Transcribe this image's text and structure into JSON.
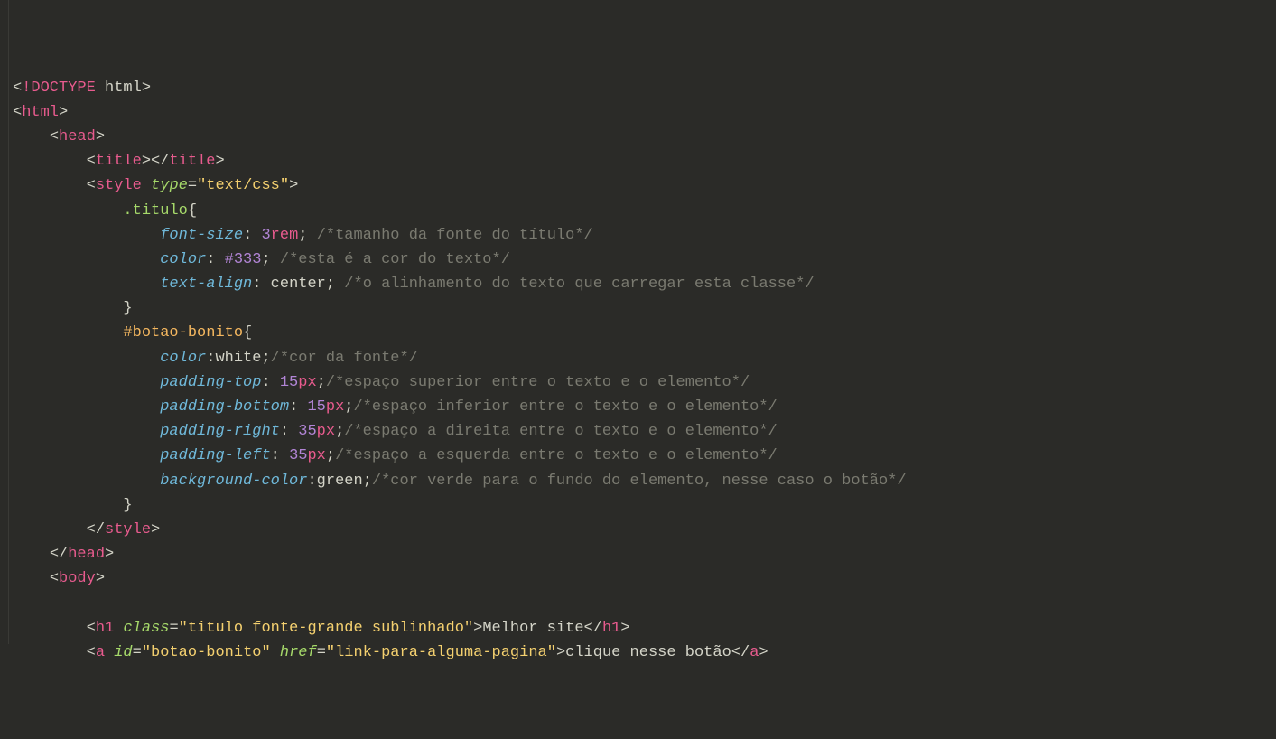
{
  "code": {
    "l1": {
      "lt": "<",
      "bang": "!",
      "kw": "DOCTYPE",
      "sp": " ",
      "val": "html",
      "gt": ">"
    },
    "l2": {
      "lt": "<",
      "tag": "html",
      "gt": ">"
    },
    "l3": {
      "ind": "    ",
      "lt": "<",
      "tag": "head",
      "gt": ">"
    },
    "l4": {
      "ind": "        ",
      "lt": "<",
      "tag": "title",
      "gt": ">",
      "lt2": "</",
      "tag2": "title",
      "gt2": ">"
    },
    "l5": {
      "ind": "        ",
      "lt": "<",
      "tag": "style",
      "sp": " ",
      "attr": "type",
      "eq": "=",
      "q1": "\"",
      "val": "text/css",
      "q2": "\"",
      "gt": ">"
    },
    "l6": {
      "ind": "            ",
      "sel": ".titulo",
      "brace": "{"
    },
    "l7": {
      "ind": "                ",
      "prop": "font-size",
      "colon": ": ",
      "num": "3",
      "unit": "rem",
      "semi": ";",
      "sp": " ",
      "cmt": "/*tamanho da fonte do título*/"
    },
    "l8": {
      "ind": "                ",
      "prop": "color",
      "colon": ": ",
      "hex": "#333",
      "semi": ";",
      "sp": " ",
      "cmt": "/*esta é a cor do texto*/"
    },
    "l9": {
      "ind": "                ",
      "prop": "text-align",
      "colon": ": ",
      "val": "center",
      "semi": ";",
      "sp": " ",
      "cmt": "/*o alinhamento do texto que carregar esta classe*/"
    },
    "l10": {
      "ind": "            ",
      "brace": "}"
    },
    "l11": {
      "ind": "            ",
      "sel": "#botao-bonito",
      "brace": "{"
    },
    "l12": {
      "ind": "                ",
      "prop": "color",
      "colon": ":",
      "val": "white",
      "semi": ";",
      "cmt": "/*cor da fonte*/"
    },
    "l13": {
      "ind": "                ",
      "prop": "padding-top",
      "colon": ": ",
      "num": "15",
      "unit": "px",
      "semi": ";",
      "cmt": "/*espaço superior entre o texto e o elemento*/"
    },
    "l14": {
      "ind": "                ",
      "prop": "padding-bottom",
      "colon": ": ",
      "num": "15",
      "unit": "px",
      "semi": ";",
      "cmt": "/*espaço inferior entre o texto e o elemento*/"
    },
    "l15": {
      "ind": "                ",
      "prop": "padding-right",
      "colon": ": ",
      "num": "35",
      "unit": "px",
      "semi": ";",
      "cmt": "/*espaço a direita entre o texto e o elemento*/"
    },
    "l16": {
      "ind": "                ",
      "prop": "padding-left",
      "colon": ": ",
      "num": "35",
      "unit": "px",
      "semi": ";",
      "cmt": "/*espaço a esquerda entre o texto e o elemento*/"
    },
    "l17": {
      "ind": "                ",
      "prop": "background-color",
      "colon": ":",
      "val": "green",
      "semi": ";",
      "cmt": "/*cor verde para o fundo do elemento, nesse caso o botão*/"
    },
    "l18": {
      "ind": "            ",
      "brace": "}"
    },
    "l19": {
      "ind": "        ",
      "lt": "</",
      "tag": "style",
      "gt": ">"
    },
    "l20": {
      "ind": "    ",
      "lt": "</",
      "tag": "head",
      "gt": ">"
    },
    "l21": {
      "ind": "    ",
      "lt": "<",
      "tag": "body",
      "gt": ">"
    },
    "l22": {
      "ind": ""
    },
    "l23": {
      "ind": "        ",
      "lt": "<",
      "tag": "h1",
      "sp": " ",
      "attr": "class",
      "eq": "=",
      "q1": "\"",
      "val": "titulo fonte-grande sublinhado",
      "q2": "\"",
      "gt": ">",
      "text": "Melhor site",
      "lt2": "</",
      "tag2": "h1",
      "gt2": ">"
    },
    "l24": {
      "ind": "        ",
      "lt": "<",
      "tag": "a",
      "sp": " ",
      "attr": "id",
      "eq": "=",
      "q1": "\"",
      "val": "botao-bonito",
      "q2": "\"",
      "sp2": " ",
      "attr2": "href",
      "eq2": "=",
      "q3": "\"",
      "val2": "link-para-alguma-pagina",
      "q4": "\"",
      "gt": ">",
      "text": "clique nesse botão",
      "lt2": "</",
      "tag2": "a",
      "gt2": ">"
    }
  }
}
